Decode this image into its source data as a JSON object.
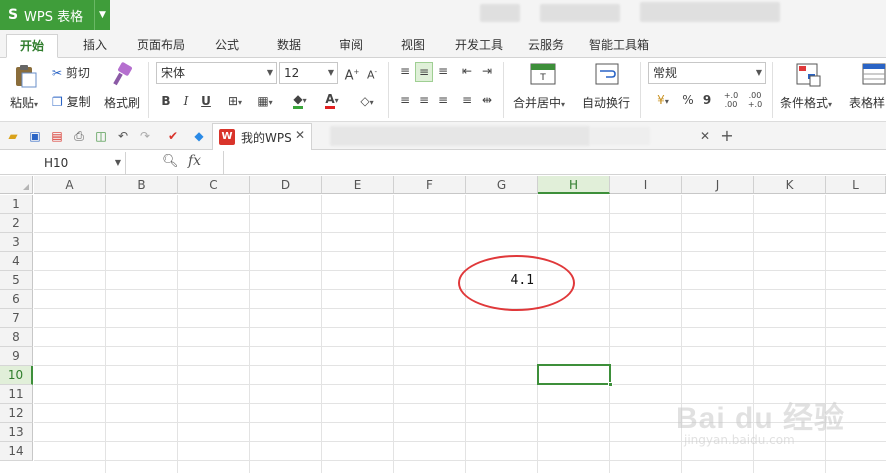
{
  "app": {
    "logo": "S",
    "name": "WPS 表格"
  },
  "menu_tabs": [
    "开始",
    "插入",
    "页面布局",
    "公式",
    "数据",
    "审阅",
    "视图",
    "开发工具",
    "云服务",
    "智能工具箱"
  ],
  "ribbon": {
    "paste": "粘贴",
    "cut": "剪切",
    "copy": "复制",
    "format_painter": "格式刷",
    "font_name": "宋体",
    "font_size": "12",
    "bold": "B",
    "italic": "I",
    "underline": "U",
    "merge_center": "合并居中",
    "wrap_text": "自动换行",
    "number_format": "常规",
    "percent": "%",
    "comma": "9",
    "conditional_format": "条件格式",
    "table_style": "表格样"
  },
  "doc_tab": {
    "label": "我的WPS"
  },
  "name_box": "H10",
  "fx_label": "fx",
  "columns": [
    "A",
    "B",
    "C",
    "D",
    "E",
    "F",
    "G",
    "H",
    "I",
    "J",
    "K",
    "L"
  ],
  "rows": [
    "1",
    "2",
    "3",
    "4",
    "5",
    "6",
    "7",
    "8",
    "9",
    "10",
    "11",
    "12",
    "13",
    "14"
  ],
  "selected_column": "H",
  "selected_row": "10",
  "cell_value": {
    "address": "G5",
    "value": "4.1"
  },
  "watermark": {
    "main": "Bai du 经验",
    "sub": "jingyan.baidu.com"
  },
  "colors": {
    "accent": "#3d8f3a",
    "annotation": "#e0383a"
  }
}
